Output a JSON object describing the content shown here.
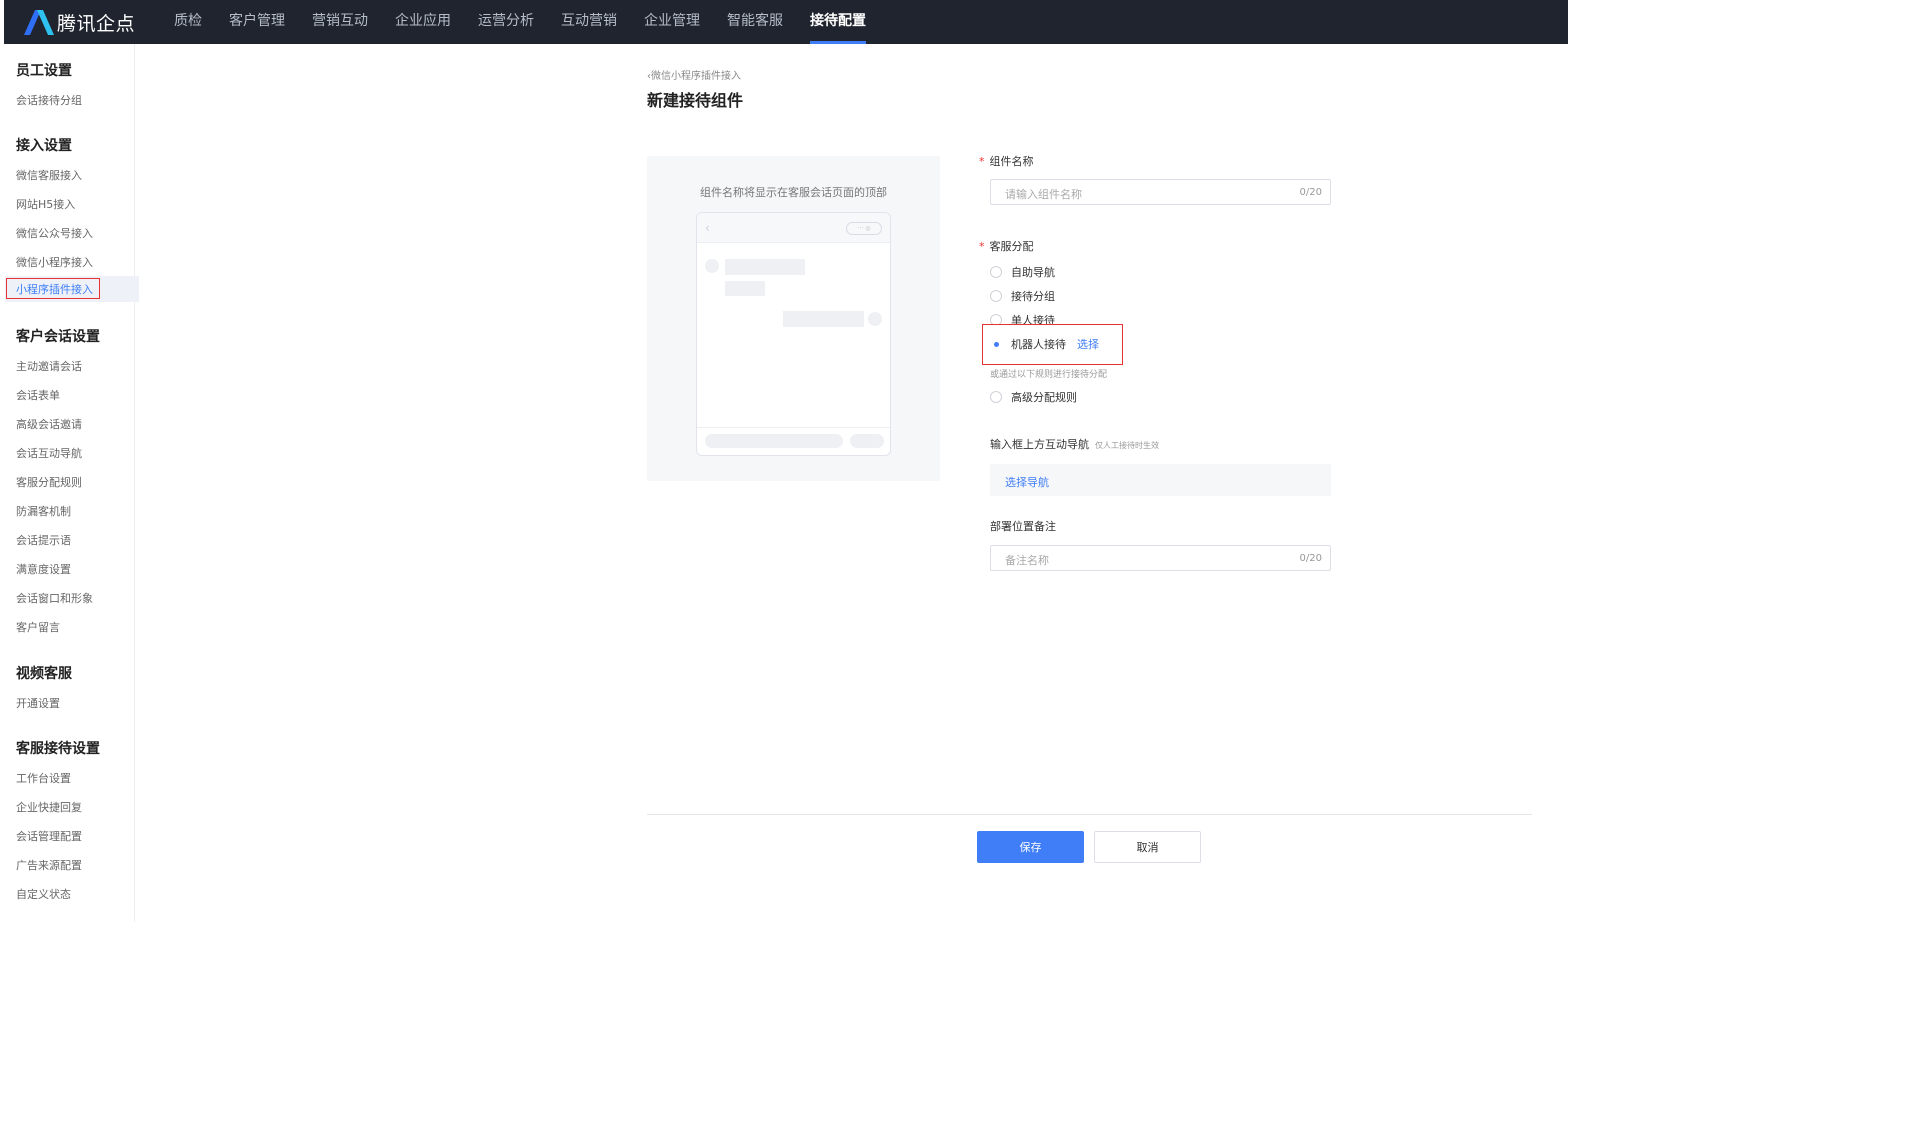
{
  "brand": {
    "name": "腾讯企点",
    "accent": "#3f7ef7"
  },
  "topnav": {
    "items": [
      "质检",
      "客户管理",
      "营销互动",
      "企业应用",
      "运营分析",
      "互动营销",
      "企业管理",
      "智能客服",
      "接待配置"
    ],
    "active": "接待配置"
  },
  "sidebar": {
    "groups": [
      {
        "title": "员工设置",
        "items": [
          "会话接待分组"
        ]
      },
      {
        "title": "接入设置",
        "items": [
          "微信客服接入",
          "网站H5接入",
          "微信公众号接入",
          "微信小程序接入",
          "小程序插件接入"
        ]
      },
      {
        "title": "客户会话设置",
        "items": [
          "主动邀请会话",
          "会话表单",
          "高级会话邀请",
          "会话互动导航",
          "客服分配规则",
          "防漏客机制",
          "会话提示语",
          "满意度设置",
          "会话窗口和形象",
          "客户留言"
        ]
      },
      {
        "title": "视频客服",
        "items": [
          "开通设置"
        ]
      },
      {
        "title": "客服接待设置",
        "items": [
          "工作台设置",
          "企业快捷回复",
          "会话管理配置",
          "广告来源配置",
          "自定义状态"
        ]
      }
    ],
    "active": "小程序插件接入"
  },
  "page": {
    "breadcrumb": "微信小程序插件接入",
    "title": "新建接待组件"
  },
  "preview": {
    "caption": "组件名称将显示在客服会话页面的顶部",
    "back_glyph": "‹",
    "capsule_glyph": "··· ◎"
  },
  "form": {
    "required_mark": "*",
    "name": {
      "label": "组件名称",
      "placeholder": "请输入组件名称",
      "counter": "0/20"
    },
    "assign": {
      "label": "客服分配",
      "options": [
        "自助导航",
        "接待分组",
        "单人接待",
        "机器人接待"
      ],
      "selected": "机器人接待",
      "select_link": "选择",
      "hint": "或通过以下规则进行接待分配",
      "advanced": "高级分配规则"
    },
    "nav": {
      "label": "输入框上方互动导航",
      "note": "仅人工接待时生效",
      "button": "选择导航"
    },
    "remark": {
      "label": "部署位置备注",
      "placeholder": "备注名称",
      "counter": "0/20"
    }
  },
  "actions": {
    "save": "保存",
    "cancel": "取消"
  }
}
